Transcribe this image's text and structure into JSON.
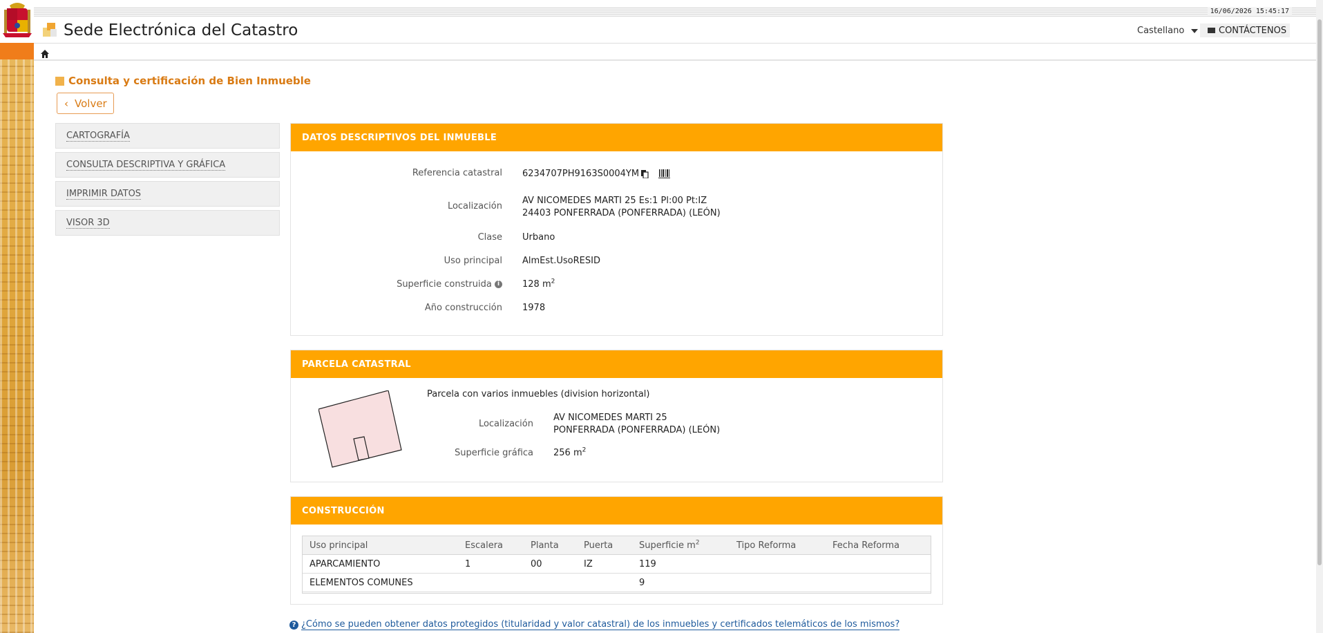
{
  "header": {
    "datetime": "16/06/2026  15:45:17",
    "site_title": "Sede Electrónica del Catastro",
    "language": "Castellano",
    "contact_label": "CONTÁCTENOS"
  },
  "page": {
    "title": "Consulta y certificación de Bien Inmueble",
    "back_label": "Volver"
  },
  "sidebar": {
    "items": [
      {
        "label": "CARTOGRAFÍA"
      },
      {
        "label": "CONSULTA DESCRIPTIVA Y GRÁFICA"
      },
      {
        "label": "IMPRIMIR DATOS"
      },
      {
        "label": "VISOR 3D"
      }
    ]
  },
  "descriptive": {
    "heading": "DATOS DESCRIPTIVOS DEL INMUEBLE",
    "ref_label": "Referencia catastral",
    "ref_value": "6234707PH9163S0004YM",
    "loc_label": "Localización",
    "loc_line1": "AV NICOMEDES MARTI 25 Es:1 Pl:00 Pt:IZ",
    "loc_line2": "24403 PONFERRADA (PONFERRADA) (LEÓN)",
    "class_label": "Clase",
    "class_value": "Urbano",
    "use_label": "Uso principal",
    "use_value": "AlmEst.UsoRESID",
    "area_label": "Superficie construida",
    "area_value": "128 m",
    "area_unit_sup": "2",
    "year_label": "Año construcción",
    "year_value": "1978"
  },
  "parcel": {
    "heading": "PARCELA CATASTRAL",
    "description": "Parcela con varios inmuebles (division horizontal)",
    "loc_label": "Localización",
    "loc_line1": "AV NICOMEDES MARTI 25",
    "loc_line2": "PONFERRADA (PONFERRADA) (LEÓN)",
    "area_label": "Superficie gráfica",
    "area_value": "256 m",
    "area_unit_sup": "2"
  },
  "construction": {
    "heading": "CONSTRUCCIÓN",
    "columns": [
      "Uso principal",
      "Escalera",
      "Planta",
      "Puerta",
      "Superficie m",
      "Tipo Reforma",
      "Fecha Reforma"
    ],
    "area_col_sup": "2",
    "rows": [
      [
        "APARCAMIENTO",
        "1",
        "00",
        "IZ",
        "119",
        "",
        ""
      ],
      [
        "ELEMENTOS COMUNES",
        "",
        "",
        "",
        "9",
        "",
        ""
      ]
    ]
  },
  "help": {
    "link_text": "¿Cómo se pueden obtener datos protegidos (titularidad y valor catastral) de los inmuebles y certificados telemáticos de los mismos?"
  },
  "colors": {
    "accent": "#ffa500",
    "title_orange": "#d97b14",
    "link_blue": "#1e5a9c"
  }
}
